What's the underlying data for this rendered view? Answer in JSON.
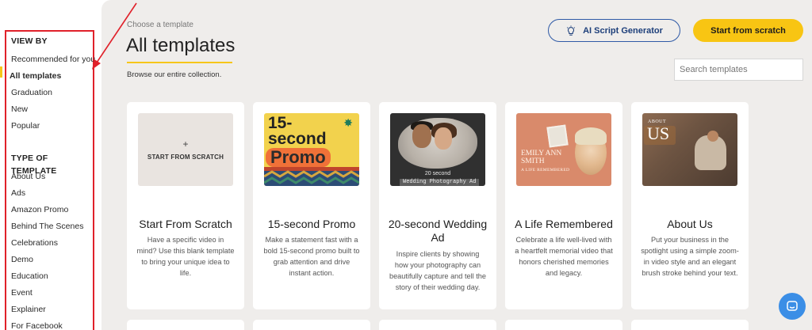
{
  "sidebar": {
    "view_by_heading": "VIEW BY",
    "view_by_items": [
      {
        "label": "Recommended for you"
      },
      {
        "label": "All templates"
      },
      {
        "label": "Graduation"
      },
      {
        "label": "New"
      },
      {
        "label": "Popular"
      }
    ],
    "type_heading": "TYPE OF TEMPLATE",
    "type_items": [
      {
        "label": "About Us"
      },
      {
        "label": "Ads"
      },
      {
        "label": "Amazon Promo"
      },
      {
        "label": "Behind The Scenes"
      },
      {
        "label": "Celebrations"
      },
      {
        "label": "Demo"
      },
      {
        "label": "Education"
      },
      {
        "label": "Event"
      },
      {
        "label": "Explainer"
      },
      {
        "label": "For Facebook"
      }
    ]
  },
  "header": {
    "breadcrumb": "Choose a template",
    "title": "All templates",
    "subtitle": "Browse our entire collection.",
    "ai_button_label": "AI Script Generator",
    "ai_button_icon": "lightbulb-icon",
    "scratch_button_label": "Start from scratch",
    "search_placeholder": "Search templates"
  },
  "cards": [
    {
      "title": "Start From Scratch",
      "description": "Have a specific video in mind? Use this blank template to bring your unique idea to life.",
      "thumb_plus": "+",
      "thumb_label": "START FROM SCRATCH"
    },
    {
      "title": "15-second Promo",
      "description": "Make a statement fast with a bold 15-second promo built to grab attention and drive instant action.",
      "thumb_line1": "15-",
      "thumb_line2": "second",
      "thumb_line3": "Promo"
    },
    {
      "title": "20-second Wedding Ad",
      "description": "Inspire clients by showing how your photography can beautifully capture and tell the story of their wedding day.",
      "thumb_small": "20 second",
      "thumb_bar": "Wedding Photography Ad"
    },
    {
      "title": "A Life Remembered",
      "description": "Celebrate a life well-lived with a heartfelt memorial video that honors cherished memories and legacy.",
      "thumb_name": "EMILY ANN SMITH",
      "thumb_sub": "A LIFE REMEMBERED"
    },
    {
      "title": "About Us",
      "description": "Put your business in the spotlight using a simple zoom-in video style and an elegant brush stroke behind your text.",
      "thumb_small": "ABOUT",
      "thumb_big": "US"
    }
  ],
  "colors": {
    "accent_yellow": "#f8c513",
    "ai_border": "#2f5aa6",
    "annotation_red": "#e0212a",
    "panel_bg": "#efedeb",
    "chat_blue": "#3b8ee6"
  }
}
